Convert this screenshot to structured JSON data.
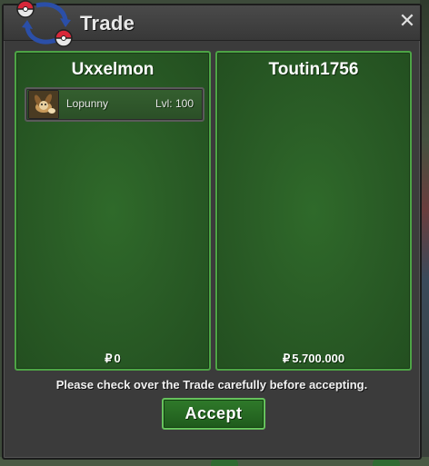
{
  "window": {
    "title": "Trade",
    "close_glyph": "✕"
  },
  "left_panel": {
    "trainer_name": "Uxxelmon",
    "items": [
      {
        "name": "Lopunny",
        "level": "Lvl: 100",
        "icon": "lopunny-sprite-icon"
      }
    ],
    "money_symbol": "₽",
    "money": "0"
  },
  "right_panel": {
    "trainer_name": "Toutin1756",
    "items": [],
    "money_symbol": "₽",
    "money": "5.700.000"
  },
  "notice": "Please check over the Trade carefully before accepting.",
  "accept_label": "Accept",
  "colors": {
    "panel_border": "#4da445",
    "panel_bg": "#2a5d26",
    "window_bg": "#3b3b3b",
    "accept_border": "#66c25c"
  }
}
